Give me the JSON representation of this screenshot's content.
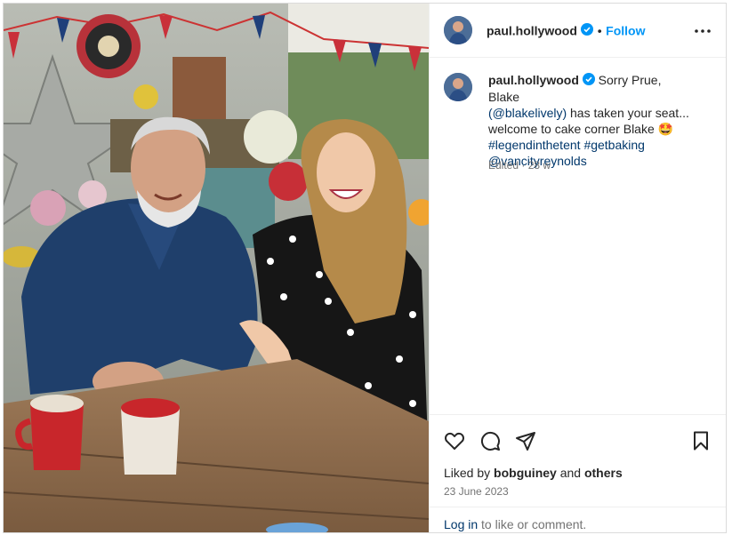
{
  "post": {
    "username": "paul.hollywood",
    "follow_label": "Follow",
    "separator": "•",
    "caption": {
      "text1": "Sorry Prue, Blake",
      "mention1": "(@blakelively)",
      "text2": "has taken your seat...",
      "text3": "welcome to cake corner Blake",
      "emoji": "🤩",
      "tag1": "#legendinthetent",
      "tag2": "#getbaking",
      "mention2": "@vancityreynolds"
    },
    "edited": "Edited",
    "age": "28 w",
    "likes": {
      "prefix": "Liked by",
      "user": "bobguiney",
      "and": "and",
      "others": "others"
    },
    "date": "23 June 2023",
    "login": {
      "link": "Log in",
      "rest": "to like or comment."
    }
  },
  "icons": [
    "verified-icon",
    "more-options-icon",
    "heart-icon",
    "comment-icon",
    "share-icon",
    "save-icon"
  ],
  "colors": {
    "accent": "#0095f6",
    "verified": "#0095f6",
    "link": "#00376b",
    "muted": "#737373"
  }
}
